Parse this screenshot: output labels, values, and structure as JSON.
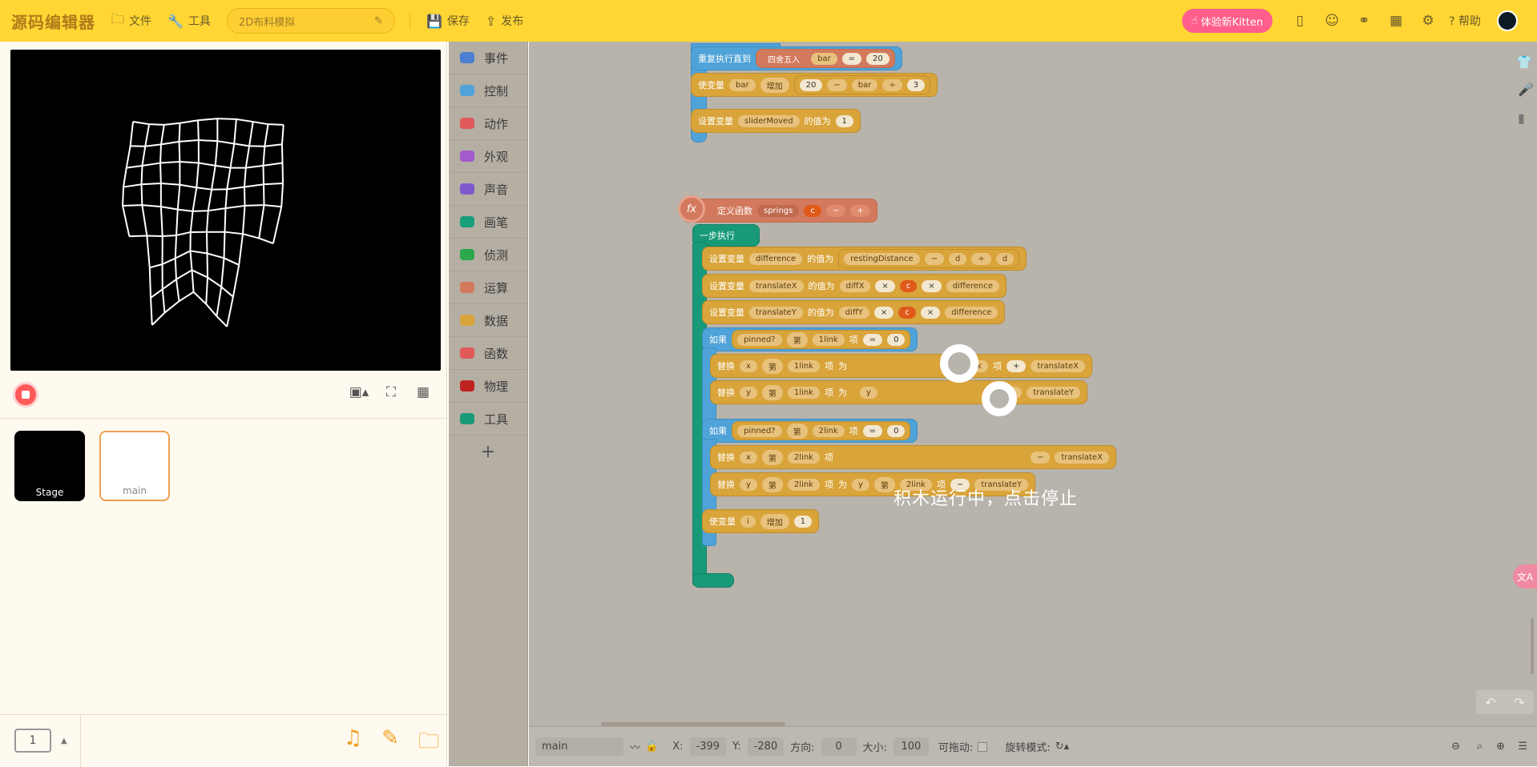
{
  "header": {
    "logo": "源码编辑器",
    "file": "文件",
    "tools": "工具",
    "project_name": "2D布料模拟",
    "save": "保存",
    "publish": "发布",
    "kitten": "体验新Kitten",
    "help": "帮助"
  },
  "stage": {
    "sprites": [
      {
        "label": "Stage"
      },
      {
        "label": "main"
      }
    ],
    "page_number": "1"
  },
  "categories": [
    "事件",
    "控制",
    "动作",
    "外观",
    "声音",
    "画笔",
    "侦测",
    "运算",
    "数据",
    "函数",
    "物理",
    "工具"
  ],
  "category_colors": [
    "#4a7fd1",
    "#4fa3d8",
    "#e05a5a",
    "#a25acd",
    "#7e5acd",
    "#18a07a",
    "#2aa84a",
    "#d37a5e",
    "#d9a43a",
    "#e05a5a",
    "#c02222",
    "#189a78"
  ],
  "blocks": {
    "repeat_until": "重复执行直到",
    "round": "四舍五入",
    "bar": "bar",
    "eq": "=",
    "n20": "20",
    "change_var": "使变量",
    "increase": "增加",
    "minus": "−",
    "divide": "÷",
    "n3": "3",
    "set_var": "设置变量",
    "slider_moved": "sliderMoved",
    "value_of": "的值为",
    "n1": "1",
    "define_func": "定义函数",
    "springs": "springs",
    "c": "c",
    "step_exec": "一步执行",
    "difference": "difference",
    "resting_distance": "restingDistance",
    "d": "d",
    "translateX": "translateX",
    "translateY": "translateY",
    "diffX": "diffX",
    "diffY": "diffY",
    "times": "×",
    "if": "如果",
    "pinned": "pinned?",
    "nth": "第",
    "link1": "1link",
    "link2": "2link",
    "item": "项",
    "n0": "0",
    "replace": "替换",
    "x": "x",
    "y": "y",
    "as": "为",
    "plus": "+",
    "i": "i",
    "running": "积木运行中，点击停止"
  },
  "statusbar": {
    "sprite": "main",
    "x_label": "X:",
    "x_val": "-399",
    "y_label": "Y:",
    "y_val": "-280",
    "dir_label": "方向:",
    "dir_val": "0",
    "size_label": "大小:",
    "size_val": "100",
    "drag_label": "可拖动:",
    "rot_label": "旋转模式:"
  }
}
